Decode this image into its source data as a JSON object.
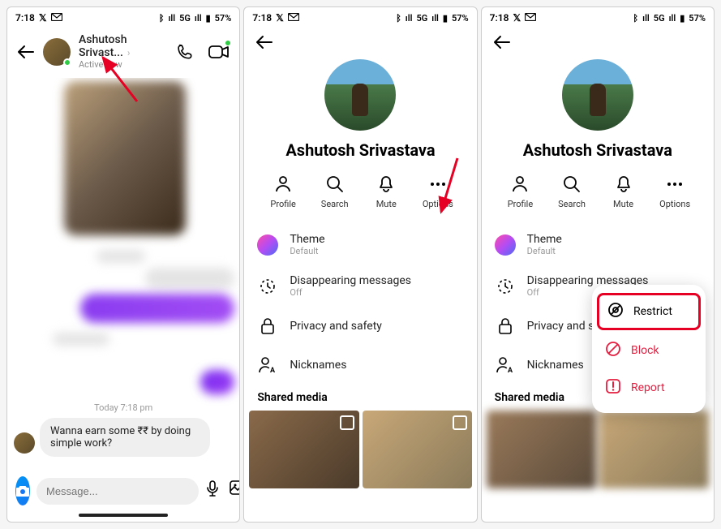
{
  "status": {
    "time": "7:18",
    "icons_left": [
      "x-icon",
      "mail-icon"
    ],
    "bt": "⁕",
    "net": "5G",
    "battery": "57%"
  },
  "chat": {
    "name": "Ashutosh Srivast...",
    "status": "Active now",
    "timestamp": "Today 7:18 pm",
    "message": "Wanna earn some ₹₹ by doing simple work?",
    "input_placeholder": "Message..."
  },
  "profile": {
    "name": "Ashutosh Srivastava",
    "actions": {
      "profile": "Profile",
      "search": "Search",
      "mute": "Mute",
      "options": "Options"
    },
    "settings": {
      "theme_title": "Theme",
      "theme_sub": "Default",
      "disappearing_title": "Disappearing messages",
      "disappearing_sub": "Off",
      "privacy": "Privacy and safety",
      "nicknames": "Nicknames"
    },
    "shared_media": "Shared media"
  },
  "popup": {
    "restrict": "Restrict",
    "block": "Block",
    "report": "Report"
  }
}
